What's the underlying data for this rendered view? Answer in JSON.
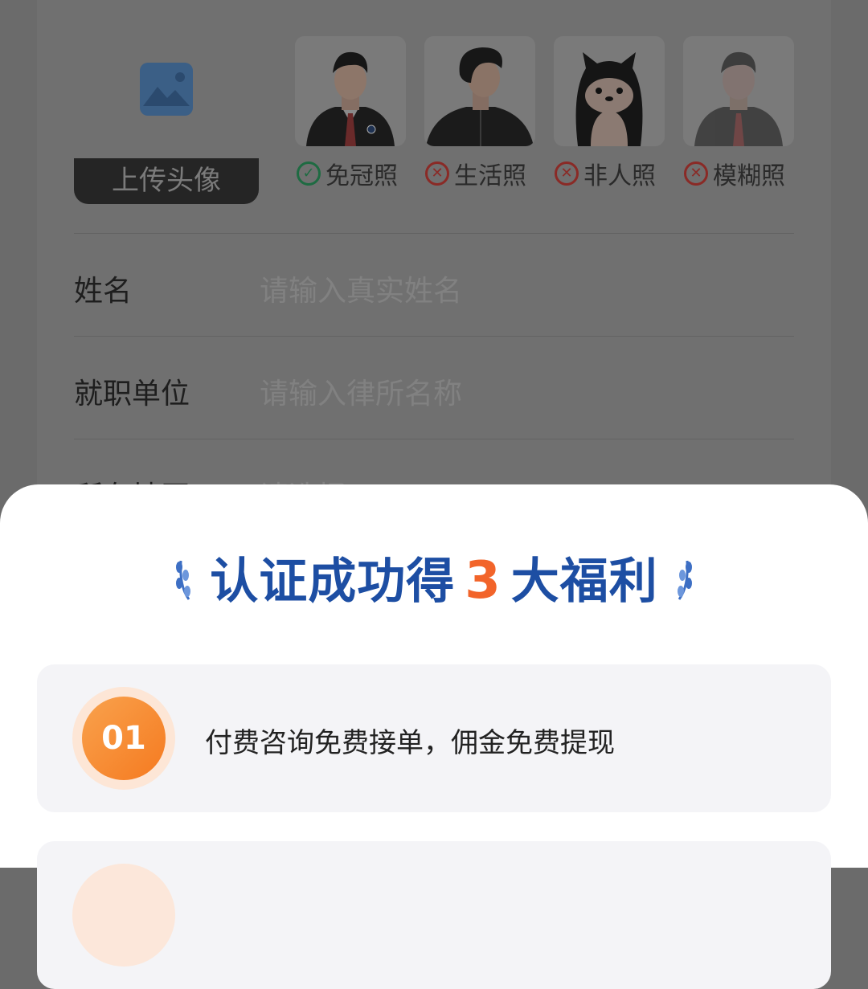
{
  "upload": {
    "label": "上传头像",
    "icon": "image-icon"
  },
  "examples": [
    {
      "caption": "免冠照",
      "status": "ok",
      "kind": "suit-lawyer"
    },
    {
      "caption": "生活照",
      "status": "bad",
      "kind": "casual-man"
    },
    {
      "caption": "非人照",
      "status": "bad",
      "kind": "dog"
    },
    {
      "caption": "模糊照",
      "status": "bad",
      "kind": "blurred-lawyer"
    }
  ],
  "form": {
    "name_label": "姓名",
    "name_placeholder": "请输入真实姓名",
    "employer_label": "就职单位",
    "employer_placeholder": "请输入律所名称",
    "region_label": "所在地区",
    "region_placeholder": "请选择"
  },
  "sheet": {
    "headline_before": "认证成功得",
    "headline_number": "3",
    "headline_after": "大福利",
    "benefits": [
      {
        "badge": "01",
        "text": "付费咨询免费接单，佣金免费提现"
      }
    ]
  },
  "colors": {
    "headline": "#1d4ea3",
    "accent": "#f2642a",
    "ok": "#2f9e65",
    "bad": "#d9433b",
    "overlay": "#6b6b6b"
  }
}
